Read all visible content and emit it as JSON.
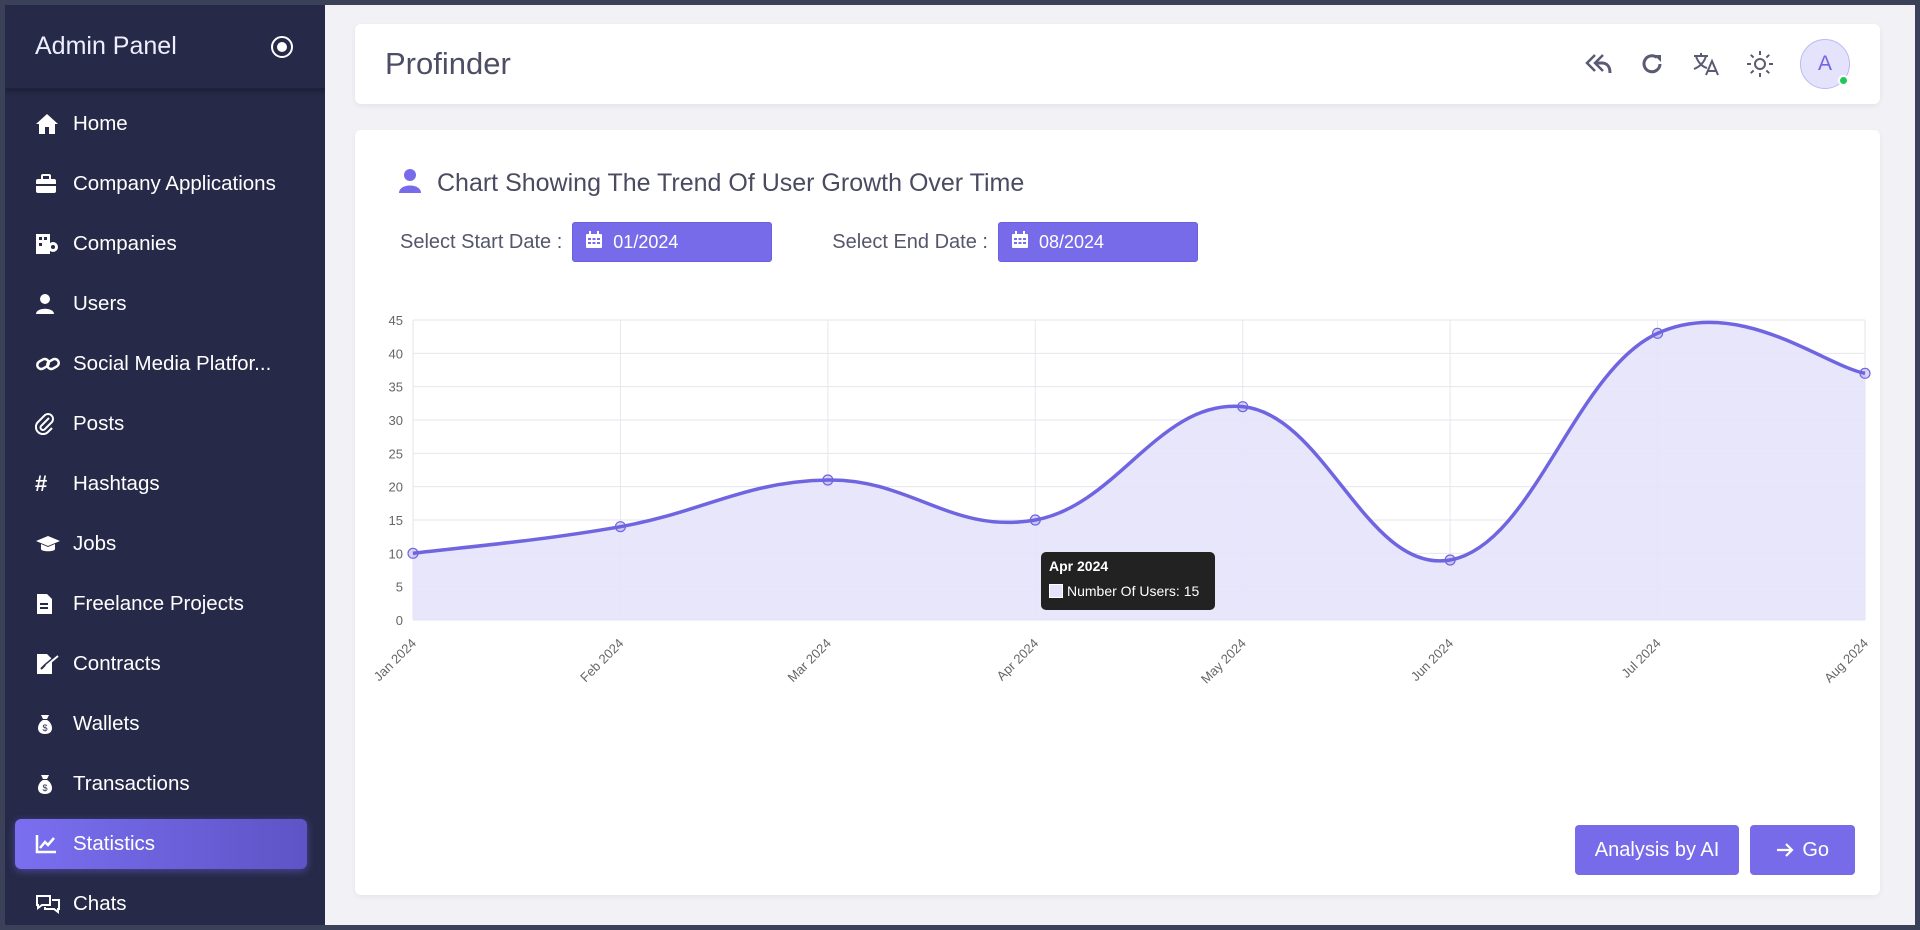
{
  "sidebar": {
    "title": "Admin Panel",
    "items": [
      {
        "label": "Home",
        "icon": "home-icon"
      },
      {
        "label": "Company Applications",
        "icon": "briefcase-icon"
      },
      {
        "label": "Companies",
        "icon": "building-icon"
      },
      {
        "label": "Users",
        "icon": "user-icon"
      },
      {
        "label": "Social Media Platfor...",
        "icon": "link-icon"
      },
      {
        "label": "Posts",
        "icon": "paperclip-icon"
      },
      {
        "label": "Hashtags",
        "icon": "hashtag-icon"
      },
      {
        "label": "Jobs",
        "icon": "graduation-cap-icon"
      },
      {
        "label": "Freelance Projects",
        "icon": "file-icon"
      },
      {
        "label": "Contracts",
        "icon": "file-signature-icon"
      },
      {
        "label": "Wallets",
        "icon": "money-bag-icon"
      },
      {
        "label": "Transactions",
        "icon": "money-bag-icon"
      },
      {
        "label": "Statistics",
        "icon": "chart-line-icon",
        "active": true
      },
      {
        "label": "Chats",
        "icon": "chat-bubbles-icon"
      }
    ]
  },
  "header": {
    "brand": "Profinder",
    "avatar_letter": "A"
  },
  "card": {
    "title": "Chart Showing The Trend Of User Growth Over Time",
    "start_label": "Select Start Date :",
    "start_value": "01/2024",
    "end_label": "Select End Date :",
    "end_value": "08/2024"
  },
  "tooltip": {
    "title": "Apr 2024",
    "line": "Number Of Users: 15"
  },
  "buttons": {
    "analysis": "Analysis by AI",
    "go": "Go"
  },
  "colors": {
    "accent": "#776be9",
    "sidebar_bg": "#262a48",
    "line": "#6f65e0",
    "fill": "#e5e3fb"
  },
  "chart_data": {
    "type": "area",
    "categories": [
      "Jan 2024",
      "Feb 2024",
      "Mar 2024",
      "Apr 2024",
      "May 2024",
      "Jun 2024",
      "Jul 2024",
      "Aug 2024"
    ],
    "series": [
      {
        "name": "Number Of Users",
        "values": [
          10,
          14,
          21,
          15,
          32,
          9,
          43,
          37
        ]
      }
    ],
    "yticks": [
      0,
      5,
      10,
      15,
      20,
      25,
      30,
      35,
      40,
      45
    ],
    "ylim": [
      0,
      45
    ],
    "grid": true,
    "title": "",
    "xlabel": "",
    "ylabel": ""
  }
}
